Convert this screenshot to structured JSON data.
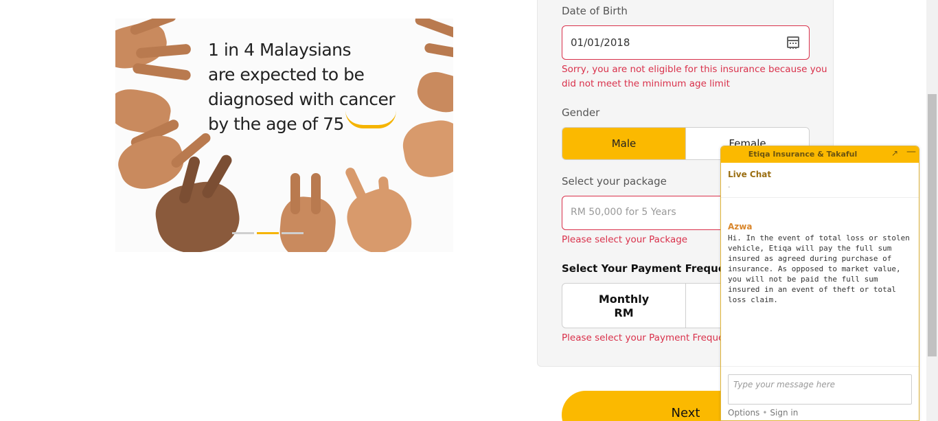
{
  "banner": {
    "lines": [
      "1 in 4 Malaysians",
      "are expected to be",
      "diagnosed with cancer",
      "by the age of 75"
    ],
    "slides_total": 3,
    "slide_active": 2
  },
  "form": {
    "dob_label": "Date of Birth",
    "dob_value": "01/01/2018",
    "dob_error_line1": "Sorry, you are not eligible for this insurance because you",
    "dob_error_line2": "did not meet the minimum age limit",
    "gender_label": "Gender",
    "gender_male": "Male",
    "gender_female": "Female",
    "gender_selected": "Male",
    "package_label": "Select your package",
    "package_placeholder": "RM 50,000 for 5 Years",
    "package_error": "Please select your Package",
    "payment_label": "Select Your Payment Frequency",
    "payment_monthly_line1": "Monthly",
    "payment_monthly_line2": "RM",
    "payment_error": "Please select your Payment Frequency",
    "next_label": "Next"
  },
  "colors": {
    "accent": "#fbb900",
    "error": "#d9304a"
  },
  "chat": {
    "title": "Etiqa Insurance & Takaful",
    "expand_icon": "expand-icon",
    "minimize_icon": "minimize-icon",
    "subtitle": "Live Chat",
    "dot": ".",
    "agent_name": "Azwa",
    "message": "Hi. In the event of total loss or stolen vehicle, Etiqa will pay the full sum insured as agreed during purchase of insurance. As opposed to market value, you will not be paid the full sum insured in an event of theft or total loss claim.",
    "input_placeholder": "Type your message here",
    "options_label": "Options",
    "signin_label": "Sign in"
  }
}
